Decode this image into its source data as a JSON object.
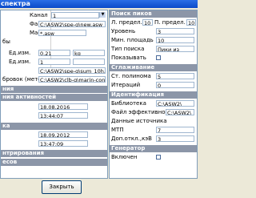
{
  "window": {
    "title": "спектра"
  },
  "left": {
    "channel": {
      "label": "Канал",
      "value": "1"
    },
    "rows": [
      {
        "label": "Файл",
        "value": "C:\\ASW2\\spe-g\\new.asw"
      },
      {
        "label": "Маска",
        "value": "*.asw"
      },
      {
        "label": "бы",
        "value": ""
      },
      {
        "label": "Ед.изм.",
        "value": "0.21",
        "unit": "kg"
      },
      {
        "label": "Ед.изм.",
        "value": "1",
        "unit": ""
      },
      {
        "label": "",
        "value": "C:\\ASW2\\spe-g\\sum_10h.s"
      },
      {
        "label": "бровок (метод",
        "value": "C:\\ASW2\\clb-g\\marin-cons"
      }
    ],
    "cat_activity": "ния",
    "cat_activity_title": "ния активностей",
    "date1": "18.08.2016",
    "time1": "13:44:07",
    "cat_mid": "ка",
    "date2": "18.09.2012",
    "time2": "13:47:09",
    "cat_integration": "нтрирования",
    "cat_weights": "есов"
  },
  "right": {
    "cat_peak_search": "Поиск пиков",
    "peak_label": "Л. предел.",
    "peak_l": "10",
    "peak_r_label": "П. предел.",
    "peak_r": "10",
    "level_label": "Уровень",
    "level": "3",
    "minarea_label": "Мин. площадь",
    "minarea": "10",
    "searchtype_label": "Тип поиска",
    "searchtype": "Пики из",
    "show_label": "Показывать",
    "cat_smoothing": "Сглаживание",
    "poly_label": "Ст. полинома",
    "poly": "5",
    "iter_label": "Итераций",
    "iter": "0",
    "cat_ident": "Идентификация",
    "lib_label": "Библиотека",
    "lib": "C:\\ASW2\\",
    "eff_label": "Файл эффективности",
    "eff": "C:\\ASW2\\",
    "src_label": "Данные источника",
    "mtp_label": "МТП",
    "mtp": "7",
    "dev_label": "Доп.откл.,кэВ",
    "dev": "3",
    "cat_gen": "Генератор",
    "enabled_label": "Включен"
  },
  "close_label": "Закрыть"
}
